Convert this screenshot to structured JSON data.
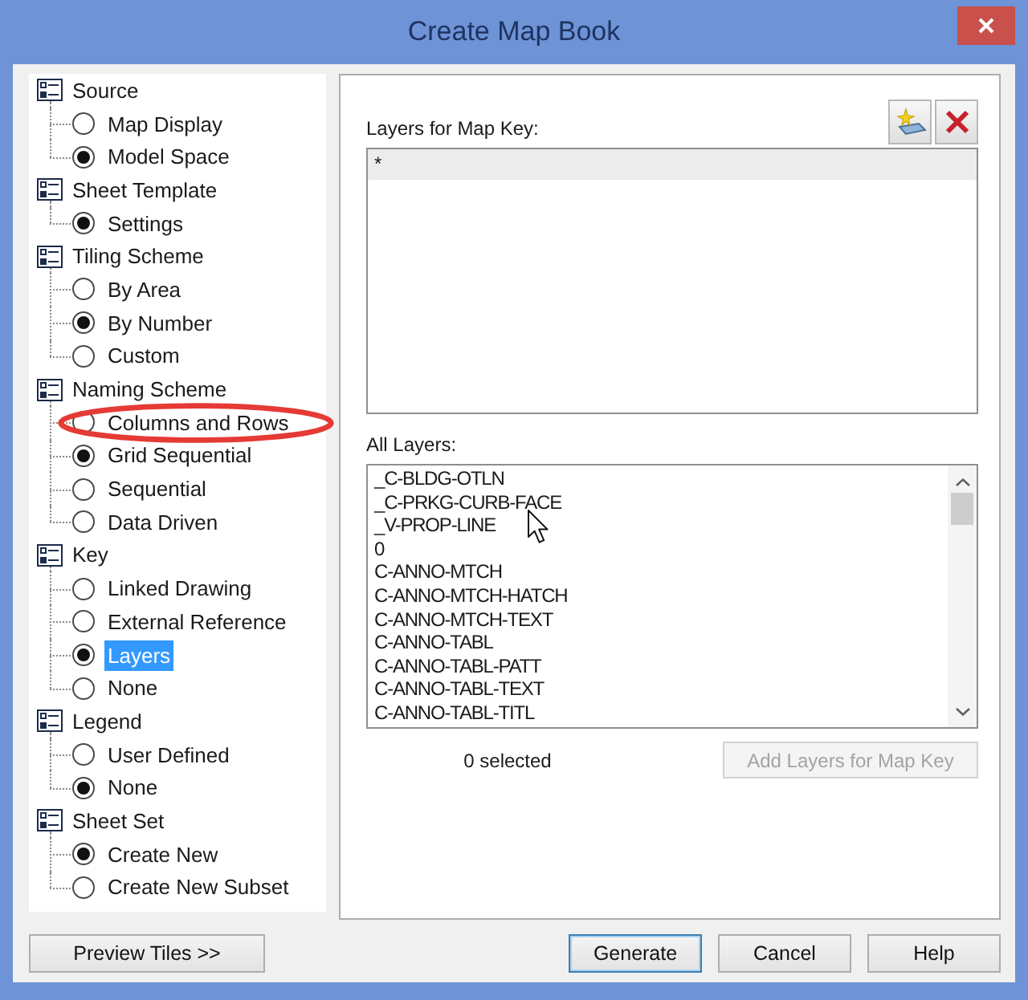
{
  "window": {
    "title": "Create Map Book"
  },
  "tree": [
    {
      "label": "Source",
      "children": [
        {
          "label": "Map Display",
          "selected": false,
          "highlighted": false,
          "circled": false
        },
        {
          "label": "Model Space",
          "selected": true,
          "highlighted": false,
          "circled": false
        }
      ]
    },
    {
      "label": "Sheet Template",
      "children": [
        {
          "label": "Settings",
          "selected": true,
          "highlighted": false,
          "circled": false
        }
      ]
    },
    {
      "label": "Tiling Scheme",
      "children": [
        {
          "label": "By Area",
          "selected": false,
          "highlighted": false,
          "circled": false
        },
        {
          "label": "By Number",
          "selected": true,
          "highlighted": false,
          "circled": false
        },
        {
          "label": "Custom",
          "selected": false,
          "highlighted": false,
          "circled": false
        }
      ]
    },
    {
      "label": "Naming Scheme",
      "children": [
        {
          "label": "Columns and Rows",
          "selected": false,
          "highlighted": false,
          "circled": true
        },
        {
          "label": "Grid Sequential",
          "selected": true,
          "highlighted": false,
          "circled": false
        },
        {
          "label": "Sequential",
          "selected": false,
          "highlighted": false,
          "circled": false
        },
        {
          "label": "Data Driven",
          "selected": false,
          "highlighted": false,
          "circled": false
        }
      ]
    },
    {
      "label": "Key",
      "children": [
        {
          "label": "Linked Drawing",
          "selected": false,
          "highlighted": false,
          "circled": false
        },
        {
          "label": "External Reference",
          "selected": false,
          "highlighted": false,
          "circled": false
        },
        {
          "label": "Layers",
          "selected": true,
          "highlighted": true,
          "circled": false
        },
        {
          "label": "None",
          "selected": false,
          "highlighted": false,
          "circled": false
        }
      ]
    },
    {
      "label": "Legend",
      "children": [
        {
          "label": "User Defined",
          "selected": false,
          "highlighted": false,
          "circled": false
        },
        {
          "label": "None",
          "selected": true,
          "highlighted": false,
          "circled": false
        }
      ]
    },
    {
      "label": "Sheet Set",
      "children": [
        {
          "label": "Create New",
          "selected": true,
          "highlighted": false,
          "circled": false
        },
        {
          "label": "Create New Subset",
          "selected": false,
          "highlighted": false,
          "circled": false
        }
      ]
    }
  ],
  "map_key": {
    "label": "Layers for Map Key:",
    "items": [
      {
        "text": "*",
        "selected": true
      }
    ]
  },
  "all_layers": {
    "label": "All Layers:",
    "items": [
      {
        "text": "_C-BLDG-OTLN",
        "selected": false
      },
      {
        "text": "_C-PRKG-CURB-FACE",
        "selected": false
      },
      {
        "text": "_V-PROP-LINE",
        "selected": false
      },
      {
        "text": "0",
        "selected": false
      },
      {
        "text": "C-ANNO-MTCH",
        "selected": false
      },
      {
        "text": "C-ANNO-MTCH-HATCH",
        "selected": false
      },
      {
        "text": "C-ANNO-MTCH-TEXT",
        "selected": false
      },
      {
        "text": "C-ANNO-TABL",
        "selected": false
      },
      {
        "text": "C-ANNO-TABL-PATT",
        "selected": false
      },
      {
        "text": "C-ANNO-TABL-TEXT",
        "selected": false
      },
      {
        "text": "C-ANNO-TABL-TITL",
        "selected": false
      }
    ],
    "selection_count": "0 selected",
    "add_button": {
      "label": "Add Layers for Map Key",
      "disabled": true
    }
  },
  "footer": {
    "left_buttons": [
      {
        "label": "Preview Tiles >>",
        "default": false
      }
    ],
    "right_buttons": [
      {
        "label": "Generate",
        "default": true
      },
      {
        "label": "Cancel",
        "default": false
      },
      {
        "label": "Help",
        "default": false
      }
    ]
  }
}
